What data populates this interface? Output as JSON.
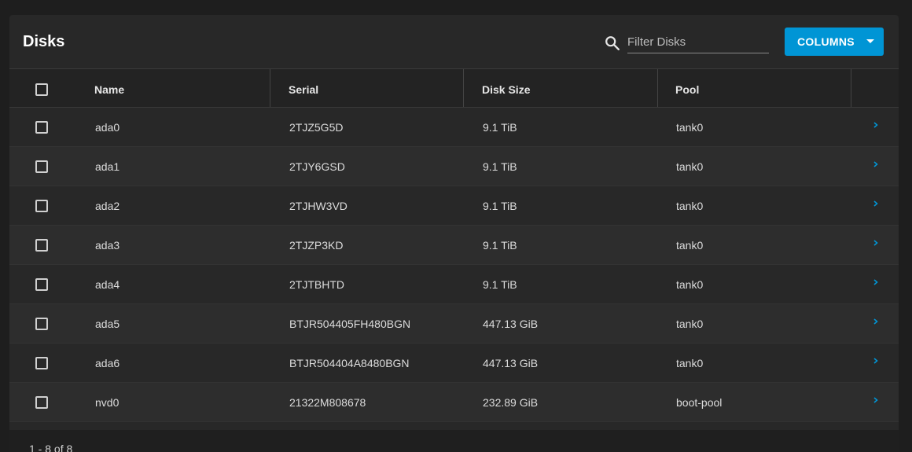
{
  "header": {
    "title": "Disks",
    "filter_placeholder": "Filter Disks",
    "columns_button": "COLUMNS"
  },
  "table": {
    "columns": [
      "Name",
      "Serial",
      "Disk Size",
      "Pool"
    ],
    "rows": [
      {
        "name": "ada0",
        "serial": "2TJZ5G5D",
        "size": "9.1 TiB",
        "pool": "tank0"
      },
      {
        "name": "ada1",
        "serial": "2TJY6GSD",
        "size": "9.1 TiB",
        "pool": "tank0"
      },
      {
        "name": "ada2",
        "serial": "2TJHW3VD",
        "size": "9.1 TiB",
        "pool": "tank0"
      },
      {
        "name": "ada3",
        "serial": "2TJZP3KD",
        "size": "9.1 TiB",
        "pool": "tank0"
      },
      {
        "name": "ada4",
        "serial": "2TJTBHTD",
        "size": "9.1 TiB",
        "pool": "tank0"
      },
      {
        "name": "ada5",
        "serial": "BTJR504405FH480BGN",
        "size": "447.13 GiB",
        "pool": "tank0"
      },
      {
        "name": "ada6",
        "serial": "BTJR504404A8480BGN",
        "size": "447.13 GiB",
        "pool": "tank0"
      },
      {
        "name": "nvd0",
        "serial": "21322M808678",
        "size": "232.89 GiB",
        "pool": "boot-pool"
      }
    ]
  },
  "footer": {
    "range": "1 - 8 of 8"
  },
  "colors": {
    "accent": "#0095d5",
    "background": "#1e1e1e",
    "card": "#282828"
  },
  "icons": {
    "search": "search-icon",
    "expand": "chevron-right-icon",
    "dropdown": "caret-down-icon"
  }
}
